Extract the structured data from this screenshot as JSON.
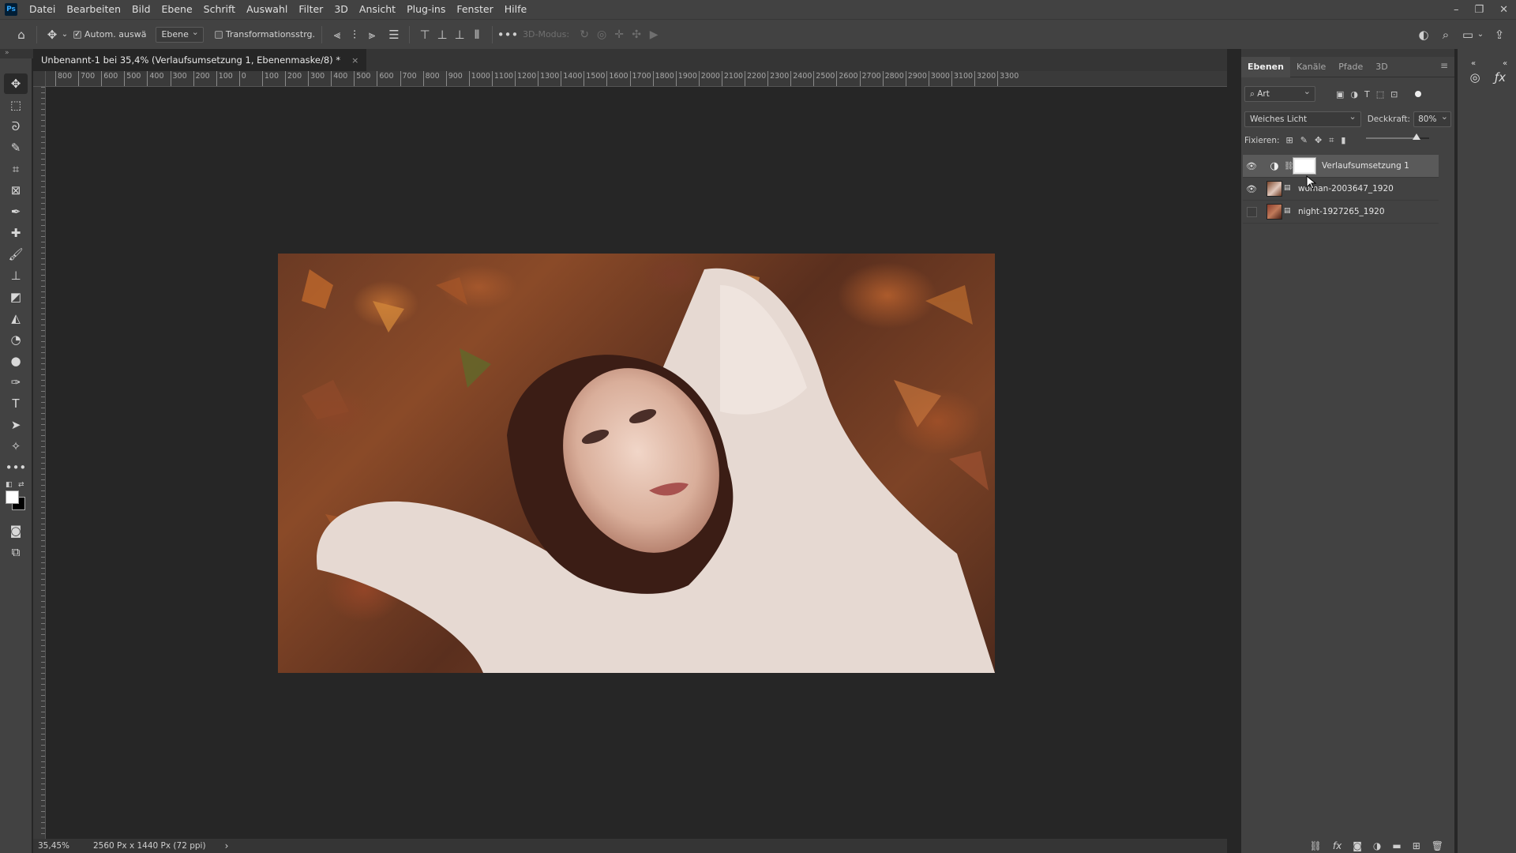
{
  "app": {
    "logo": "Ps",
    "menu": [
      "Datei",
      "Bearbeiten",
      "Bild",
      "Ebene",
      "Schrift",
      "Auswahl",
      "Filter",
      "3D",
      "Ansicht",
      "Plug-ins",
      "Fenster",
      "Hilfe"
    ],
    "window_controls": [
      "–",
      "❐",
      "✕"
    ]
  },
  "options_bar": {
    "auto_select_label": "Autom. auswä",
    "auto_select_checked": true,
    "auto_select_target": "Ebene",
    "transform_controls_label": "Transformationsstrg.",
    "transform_controls_checked": false,
    "mode_3d_label": "3D-Modus:"
  },
  "document": {
    "tab_title": "Unbenannt-1 bei 35,4% (Verlaufsumsetzung 1, Ebenenmaske/8) *",
    "close": "×",
    "zoom": "35,45%",
    "size_info": "2560 Px x 1440 Px (72 ppi)",
    "status_arrow": "›"
  },
  "ruler": {
    "top_ticks": [
      "800",
      "700",
      "600",
      "500",
      "400",
      "300",
      "200",
      "100",
      "0",
      "100",
      "200",
      "300",
      "400",
      "500",
      "600",
      "700",
      "800",
      "900",
      "1000",
      "1100",
      "1200",
      "1300",
      "1400",
      "1500",
      "1600",
      "1700",
      "1800",
      "1900",
      "2000",
      "2100",
      "2200",
      "2300",
      "2400",
      "2500",
      "2600",
      "2700",
      "2800",
      "2900",
      "3000",
      "3100",
      "3200",
      "3300"
    ]
  },
  "layers_panel": {
    "tabs": [
      "Ebenen",
      "Kanäle",
      "Pfade",
      "3D"
    ],
    "active_tab": "Ebenen",
    "filter_kind": "Art",
    "blend_mode": "Weiches Licht",
    "opacity_label": "Deckkraft:",
    "opacity": "80%",
    "opacity_fraction": 0.8,
    "lock_label": "Fixieren:",
    "layers": [
      {
        "name": "Verlaufsumsetzung 1",
        "visible": true,
        "selected": true,
        "type": "adjustment"
      },
      {
        "name": "woman-2003647_1920",
        "visible": true,
        "selected": false,
        "type": "smart"
      },
      {
        "name": "night-1927265_1920",
        "visible": false,
        "selected": false,
        "type": "smart"
      }
    ]
  },
  "colors": {
    "foreground": "#ffffff",
    "background": "#000000",
    "ui_dark": "#262626",
    "ui_panel": "#424242"
  }
}
